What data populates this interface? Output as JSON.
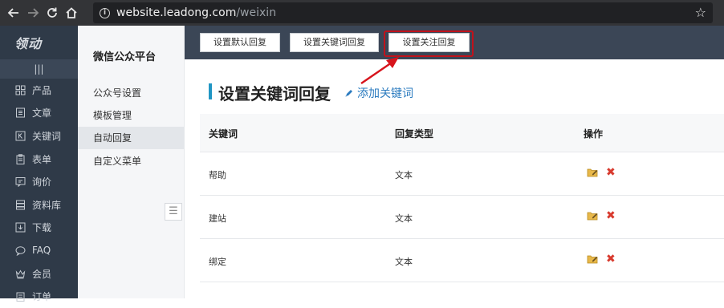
{
  "browser": {
    "url_host": "website.leadong.com",
    "url_path": "/weixin"
  },
  "sidebar": {
    "logo": "领动",
    "collapse_icon": "|||",
    "items": [
      {
        "label": "产品",
        "icon": "grid-icon"
      },
      {
        "label": "文章",
        "icon": "document-icon"
      },
      {
        "label": "关键词",
        "icon": "k-icon"
      },
      {
        "label": "表单",
        "icon": "clipboard-icon"
      },
      {
        "label": "询价",
        "icon": "inquiry-icon"
      },
      {
        "label": "资料库",
        "icon": "database-icon"
      },
      {
        "label": "下载",
        "icon": "download-icon"
      },
      {
        "label": "FAQ",
        "icon": "chat-icon"
      },
      {
        "label": "会员",
        "icon": "crown-icon"
      },
      {
        "label": "订单",
        "icon": "order-icon"
      }
    ]
  },
  "subnav": {
    "title": "微信公众平台",
    "items": [
      {
        "label": "公众号设置",
        "active": false
      },
      {
        "label": "模板管理",
        "active": false
      },
      {
        "label": "自动回复",
        "active": true
      },
      {
        "label": "自定义菜单",
        "active": false
      }
    ],
    "toggle_icon": "☰"
  },
  "tabs": [
    {
      "label": "设置默认回复"
    },
    {
      "label": "设置关键词回复"
    },
    {
      "label": "设置关注回复",
      "highlighted": true
    }
  ],
  "page": {
    "title": "设置关键词回复",
    "add_link": "添加关键词"
  },
  "table": {
    "headers": [
      "关键词",
      "回复类型",
      "操作"
    ],
    "rows": [
      {
        "keyword": "帮助",
        "type": "文本"
      },
      {
        "keyword": "建站",
        "type": "文本"
      },
      {
        "keyword": "绑定",
        "type": "文本"
      }
    ]
  },
  "colors": {
    "sidebar_bg": "#2f3a48",
    "topbar_bg": "#3b4656",
    "accent": "#2196c4",
    "highlight": "#c1121b",
    "link": "#2b7bbf"
  }
}
